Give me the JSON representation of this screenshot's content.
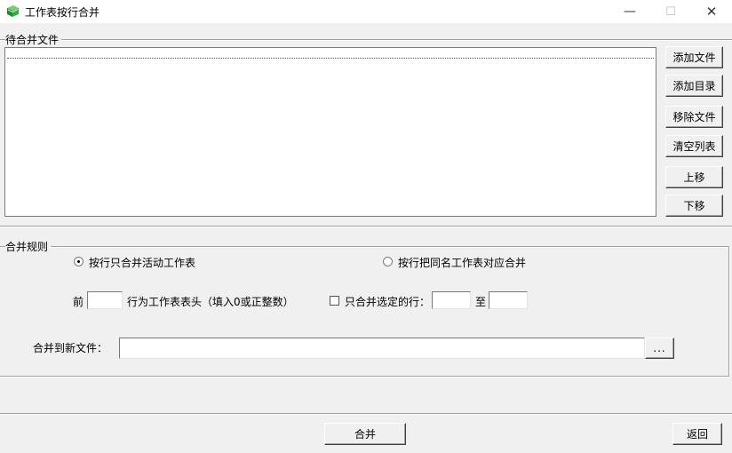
{
  "window": {
    "title": "工作表按行合并",
    "minimize_glyph": "—",
    "maximize_glyph": "☐",
    "close_glyph": "✕",
    "icon": "excel-book-icon"
  },
  "files_group": {
    "label": "待合并文件",
    "buttons": {
      "add_file": "添加文件",
      "add_dir": "添加目录",
      "remove_file": "移除文件",
      "clear_list": "清空列表",
      "move_up": "上移",
      "move_down": "下移"
    }
  },
  "rules_group": {
    "label": "合并规则",
    "radio_active_only": "按行只合并活动工作表",
    "radio_same_name": "按行把同名工作表对应合并",
    "header_prefix": "前",
    "header_rows_value": "",
    "header_suffix": "行为工作表表头（填入0或正整数）",
    "only_selected_rows": "只合并选定的行：",
    "rows_from_value": "",
    "rows_to_label": "至",
    "rows_to_value": "",
    "output_label": "合并到新文件：",
    "output_value": "",
    "browse_button": "..."
  },
  "footer": {
    "merge_button": "合并",
    "back_button": "返回"
  }
}
